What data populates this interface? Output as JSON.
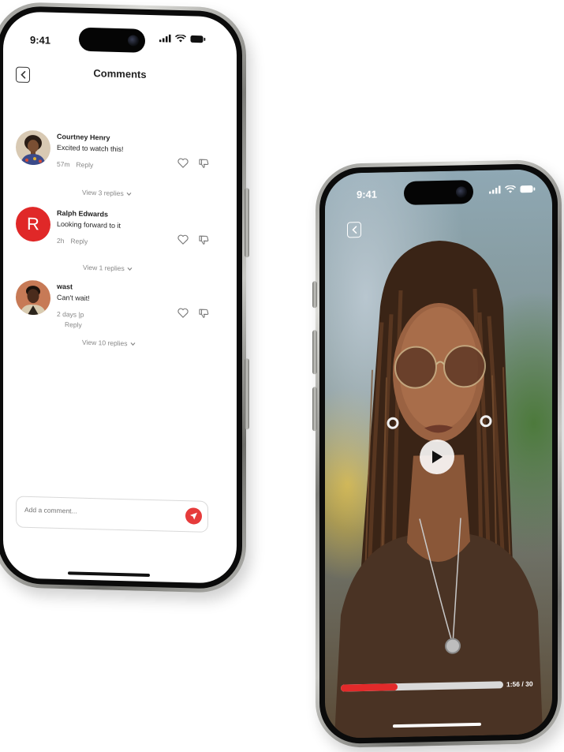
{
  "left_phone": {
    "status_time": "9:41",
    "header": {
      "title": "Comments"
    },
    "comments": [
      {
        "author": "Courtney Henry",
        "text": "Excited to watch this!",
        "time": "57m",
        "reply_label": "Reply",
        "view_replies": "View 3 replies",
        "avatar": "photo"
      },
      {
        "author": "Ralph Edwards",
        "text": "Looking forward to it",
        "time": "2h",
        "reply_label": "Reply",
        "view_replies": "View 1 replies",
        "avatar": "letter",
        "avatar_letter": "R",
        "avatar_color": "#e02828"
      },
      {
        "author": "wast",
        "text": "Can't wait!",
        "time": "2 days |p",
        "reply_label": "Reply",
        "view_replies": "View 10 replies",
        "avatar": "photo"
      }
    ],
    "input": {
      "placeholder": "Add a comment..."
    },
    "accent_color": "#e63b3b"
  },
  "right_phone": {
    "status_time": "9:41",
    "progress": {
      "label": "1:56 / 30",
      "fraction": 0.35
    },
    "accent_color": "#e22a2a"
  }
}
